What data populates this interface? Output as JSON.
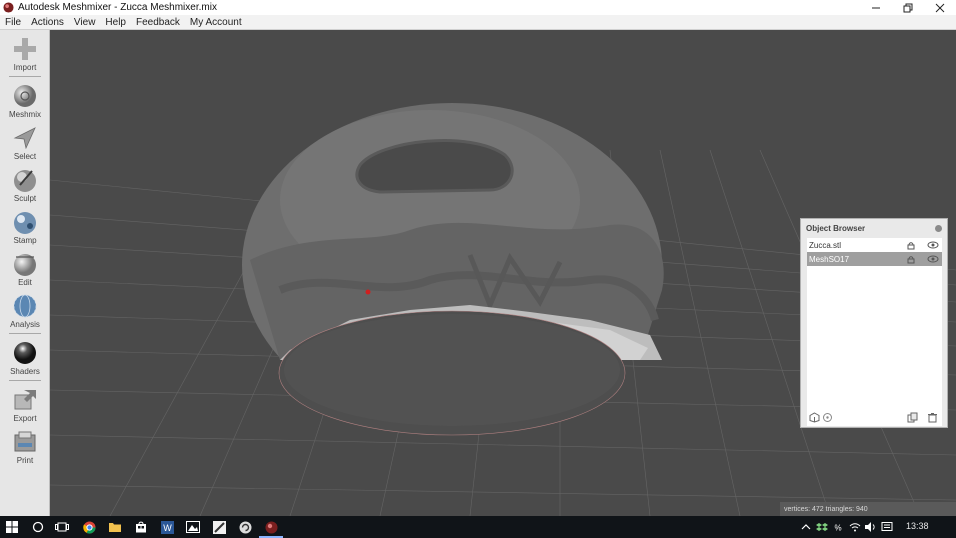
{
  "window": {
    "title": "Autodesk Meshmixer - Zucca Meshmixer.mix"
  },
  "menu": [
    "File",
    "Actions",
    "View",
    "Help",
    "Feedback",
    "My Account"
  ],
  "tools": [
    {
      "label": "Import",
      "icon": "plus-icon"
    },
    {
      "label": "Meshmix",
      "icon": "meshmix-sphere-icon"
    },
    {
      "label": "Select",
      "icon": "select-arrow-icon"
    },
    {
      "label": "Sculpt",
      "icon": "sculpt-brush-icon"
    },
    {
      "label": "Stamp",
      "icon": "stamp-icon"
    },
    {
      "label": "Edit",
      "icon": "edit-sphere-icon"
    },
    {
      "label": "Analysis",
      "icon": "analysis-sphere-icon"
    },
    {
      "label": "Shaders",
      "icon": "shaders-sphere-icon"
    },
    {
      "label": "Export",
      "icon": "export-icon"
    },
    {
      "label": "Print",
      "icon": "print-icon"
    }
  ],
  "object_browser": {
    "title": "Object Browser",
    "objects": [
      {
        "name": "Zucca.stl",
        "selected": false
      },
      {
        "name": "MeshSO17",
        "selected": true
      }
    ]
  },
  "status": {
    "text": "vertices: 472 triangles: 940"
  },
  "taskbar": {
    "clock": "13:38"
  },
  "colors": {
    "viewport_bg": "#4a4a4a",
    "mesh": "#6e6e6e",
    "selected_row": "#9f9f9f",
    "taskbar": "#101418"
  }
}
